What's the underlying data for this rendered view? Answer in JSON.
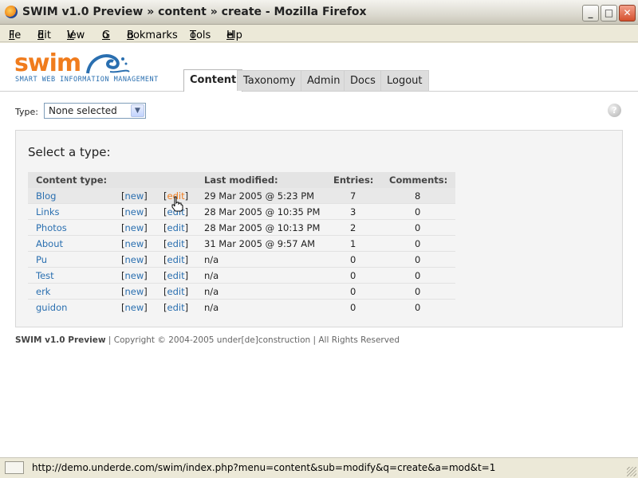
{
  "window": {
    "title": "SWIM v1.0 Preview » content » create - Mozilla Firefox",
    "min_label": "_",
    "max_label": "□",
    "close_label": "✕"
  },
  "menubar": {
    "items": [
      {
        "ul": "F",
        "rest": "ile"
      },
      {
        "ul": "E",
        "rest": "dit"
      },
      {
        "ul": "V",
        "rest": "iew"
      },
      {
        "ul": "G",
        "rest": "o"
      },
      {
        "ul": "B",
        "rest": "ookmarks"
      },
      {
        "ul": "T",
        "rest": "ools"
      },
      {
        "ul": "H",
        "rest": "elp"
      }
    ]
  },
  "header": {
    "logo": "swim",
    "logo_sub": "SMART WEB INFORMATION MANAGEMENT",
    "tabs": [
      {
        "label": "Content",
        "active": true
      },
      {
        "label": "Taxonomy",
        "active": false
      },
      {
        "label": "Admin",
        "active": false
      },
      {
        "label": "Docs",
        "active": false
      },
      {
        "label": "Logout",
        "active": false
      }
    ]
  },
  "type_filter": {
    "label": "Type:",
    "selected": "None selected",
    "arrow": "▼",
    "help": "?"
  },
  "panel": {
    "title": "Select a type:",
    "columns": {
      "content_type": "Content type:",
      "last_modified": "Last modified:",
      "entries": "Entries:",
      "comments": "Comments:"
    },
    "new_label": "new",
    "edit_label": "edit",
    "rows": [
      {
        "name": "Blog",
        "modified": "29 Mar 2005 @ 5:23 PM",
        "entries": "7",
        "comments": "8"
      },
      {
        "name": "Links",
        "modified": "28 Mar 2005 @ 10:35 PM",
        "entries": "3",
        "comments": "0"
      },
      {
        "name": "Photos",
        "modified": "28 Mar 2005 @ 10:13 PM",
        "entries": "2",
        "comments": "0"
      },
      {
        "name": "About",
        "modified": "31 Mar 2005 @ 9:57 AM",
        "entries": "1",
        "comments": "0"
      },
      {
        "name": "Pu",
        "modified": "n/a",
        "entries": "0",
        "comments": "0"
      },
      {
        "name": "Test",
        "modified": "n/a",
        "entries": "0",
        "comments": "0"
      },
      {
        "name": "erk",
        "modified": "n/a",
        "entries": "0",
        "comments": "0"
      },
      {
        "name": "guidon",
        "modified": "n/a",
        "entries": "0",
        "comments": "0"
      }
    ]
  },
  "footer": {
    "brand": "SWIM v1.0 Preview",
    "rest": " | Copyright © 2004-2005 under[de]construction | All Rights Reserved"
  },
  "statusbar": {
    "url": "http://demo.underde.com/swim/index.php?menu=content&sub=modify&q=create&a=mod&t=1"
  },
  "colors": {
    "brand_orange": "#f07c1d",
    "link_blue": "#2a6fb0"
  }
}
